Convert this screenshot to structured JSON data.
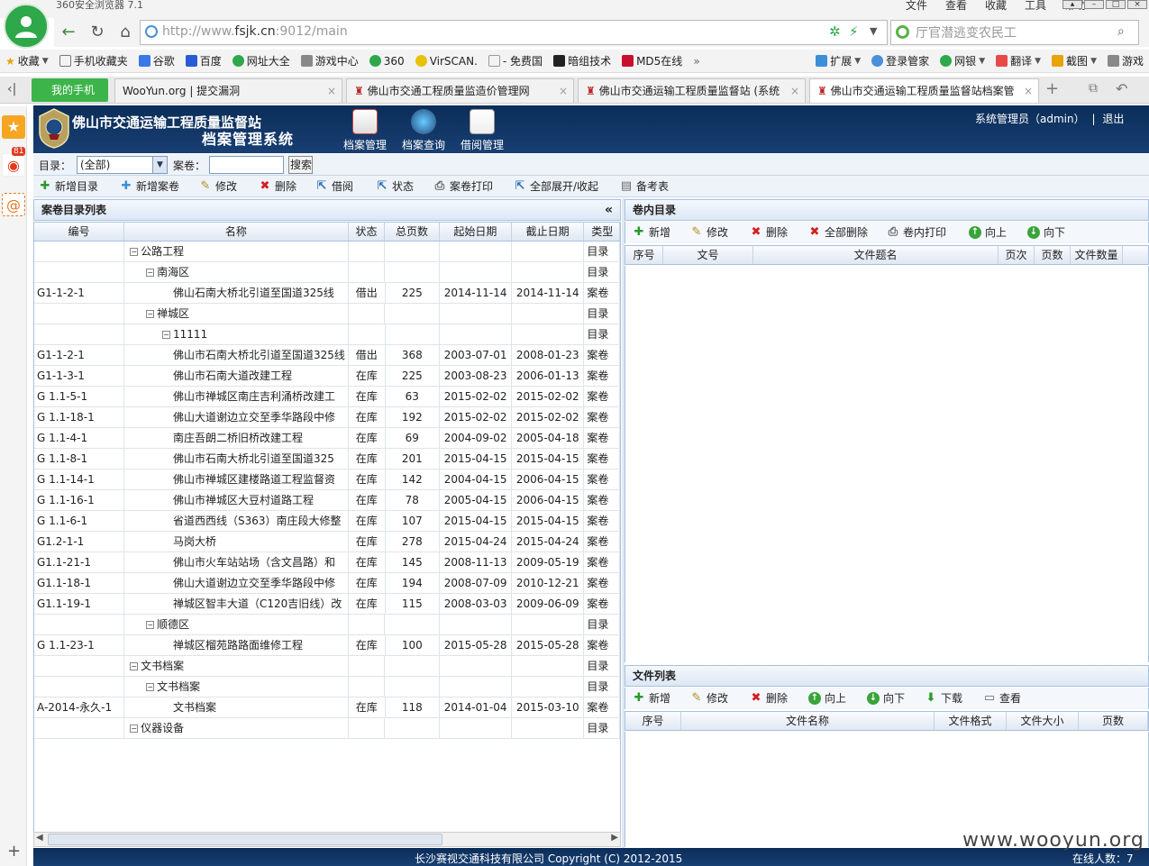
{
  "browser": {
    "title": "360安全浏览器 7.1",
    "menu": [
      "文件",
      "查看",
      "收藏",
      "工具",
      "帮助"
    ],
    "url_prefix": "http://www.",
    "url_domain": "fsjk.cn",
    "url_suffix": ":9012/main",
    "search_placeholder": "厅官潜逃变农民工",
    "favorites": [
      "收藏",
      "手机收藏夹",
      "谷歌",
      "百度",
      "网址大全",
      "游戏中心",
      "360",
      "VirSCAN.",
      "- 免费国",
      "暗组技术",
      "MD5在线"
    ],
    "favorites_right": [
      "扩展",
      "登录管家",
      "网银",
      "翻译",
      "截图",
      "游戏"
    ],
    "tabs": [
      {
        "label": "我的手机"
      },
      {
        "label": "WooYun.org | 提交漏洞"
      },
      {
        "label": "佛山市交通工程质量监造价管理网"
      },
      {
        "label": "佛山市交通运输工程质量监督站 (系统"
      },
      {
        "label": "佛山市交通运输工程质量监督站档案管"
      }
    ],
    "side_badge": "81"
  },
  "app": {
    "site_name": "佛山市交通运输工程质量监督站",
    "system_name": "档案管理系统",
    "modules": [
      "档案管理",
      "档案查询",
      "借阅管理"
    ],
    "user": "系统管理员（admin）",
    "logout": "退出",
    "filter": {
      "dir_label": "目录：",
      "dir_value": "(全部)",
      "vol_label": "案卷：",
      "vol_value": "",
      "search_button": "搜索"
    },
    "actions": [
      "新增目录",
      "新增案卷",
      "修改",
      "删除",
      "借阅",
      "状态",
      "案卷打印",
      "全部展开/收起",
      "备考表"
    ],
    "left_panel": {
      "title": "案卷目录列表",
      "collapse": "«",
      "columns": [
        "编号",
        "名称",
        "状态",
        "总页数",
        "起始日期",
        "截止日期",
        "类型"
      ],
      "rows": [
        {
          "code": "",
          "name": "公路工程",
          "level": 0,
          "node": true,
          "status": "",
          "pages": "",
          "start": "",
          "end": "",
          "type": "目录"
        },
        {
          "code": "",
          "name": "南海区",
          "level": 1,
          "node": true,
          "status": "",
          "pages": "",
          "start": "",
          "end": "",
          "type": "目录"
        },
        {
          "code": "G1-1-2-1",
          "name": "佛山石南大桥北引道至国道325线",
          "level": 2,
          "node": false,
          "status": "借出",
          "pages": "225",
          "start": "2014-11-14",
          "end": "2014-11-14",
          "type": "案卷"
        },
        {
          "code": "",
          "name": "禅城区",
          "level": 1,
          "node": true,
          "status": "",
          "pages": "",
          "start": "",
          "end": "",
          "type": "目录"
        },
        {
          "code": "",
          "name": "11111",
          "level": 2,
          "node": true,
          "status": "",
          "pages": "",
          "start": "",
          "end": "",
          "type": "目录"
        },
        {
          "code": "G1-1-2-1",
          "name": "佛山市石南大桥北引道至国道325线",
          "level": 2,
          "node": false,
          "status": "借出",
          "pages": "368",
          "start": "2003-07-01",
          "end": "2008-01-23",
          "type": "案卷"
        },
        {
          "code": "G1-1-3-1",
          "name": "佛山市石南大道改建工程",
          "level": 2,
          "node": false,
          "status": "在库",
          "pages": "225",
          "start": "2003-08-23",
          "end": "2006-01-13",
          "type": "案卷"
        },
        {
          "code": "G 1.1-5-1",
          "name": "佛山市禅城区南庄吉利涌桥改建工",
          "level": 2,
          "node": false,
          "status": "在库",
          "pages": "63",
          "start": "2015-02-02",
          "end": "2015-02-02",
          "type": "案卷"
        },
        {
          "code": "G 1.1-18-1",
          "name": "佛山大道谢边立交至季华路段中修",
          "level": 2,
          "node": false,
          "status": "在库",
          "pages": "192",
          "start": "2015-02-02",
          "end": "2015-02-02",
          "type": "案卷"
        },
        {
          "code": "G 1.1-4-1",
          "name": "南庄吾朗二桥旧桥改建工程",
          "level": 2,
          "node": false,
          "status": "在库",
          "pages": "69",
          "start": "2004-09-02",
          "end": "2005-04-18",
          "type": "案卷"
        },
        {
          "code": "G 1.1-8-1",
          "name": "佛山市石南大桥北引道至国道325",
          "level": 2,
          "node": false,
          "status": "在库",
          "pages": "201",
          "start": "2015-04-15",
          "end": "2015-04-15",
          "type": "案卷"
        },
        {
          "code": "G 1.1-14-1",
          "name": "佛山市禅城区建楼路道工程监督资",
          "level": 2,
          "node": false,
          "status": "在库",
          "pages": "142",
          "start": "2004-04-15",
          "end": "2006-04-15",
          "type": "案卷"
        },
        {
          "code": "G 1.1-16-1",
          "name": "佛山市禅城区大豆村道路工程",
          "level": 2,
          "node": false,
          "status": "在库",
          "pages": "78",
          "start": "2005-04-15",
          "end": "2006-04-15",
          "type": "案卷"
        },
        {
          "code": "G 1.1-6-1",
          "name": "省道西西线（S363）南庄段大修整",
          "level": 2,
          "node": false,
          "status": "在库",
          "pages": "107",
          "start": "2015-04-15",
          "end": "2015-04-15",
          "type": "案卷"
        },
        {
          "code": "G1.2-1-1",
          "name": "马岗大桥",
          "level": 2,
          "node": false,
          "status": "在库",
          "pages": "278",
          "start": "2015-04-24",
          "end": "2015-04-24",
          "type": "案卷"
        },
        {
          "code": "G1.1-21-1",
          "name": "佛山市火车站站场（含文昌路）和",
          "level": 2,
          "node": false,
          "status": "在库",
          "pages": "145",
          "start": "2008-11-13",
          "end": "2009-05-19",
          "type": "案卷"
        },
        {
          "code": "G1.1-18-1",
          "name": "佛山大道谢边立交至季华路段中修",
          "level": 2,
          "node": false,
          "status": "在库",
          "pages": "194",
          "start": "2008-07-09",
          "end": "2010-12-21",
          "type": "案卷"
        },
        {
          "code": "G1.1-19-1",
          "name": "禅城区智丰大道（C120吉旧线）改",
          "level": 2,
          "node": false,
          "status": "在库",
          "pages": "115",
          "start": "2008-03-03",
          "end": "2009-06-09",
          "type": "案卷"
        },
        {
          "code": "",
          "name": "顺德区",
          "level": 1,
          "node": true,
          "status": "",
          "pages": "",
          "start": "",
          "end": "",
          "type": "目录"
        },
        {
          "code": "G 1.1-23-1",
          "name": "禅城区榴苑路路面维修工程",
          "level": 2,
          "node": false,
          "status": "在库",
          "pages": "100",
          "start": "2015-05-28",
          "end": "2015-05-28",
          "type": "案卷"
        },
        {
          "code": "",
          "name": "文书档案",
          "level": 0,
          "node": true,
          "status": "",
          "pages": "",
          "start": "",
          "end": "",
          "type": "目录"
        },
        {
          "code": "",
          "name": "文书档案",
          "level": 1,
          "node": true,
          "status": "",
          "pages": "",
          "start": "",
          "end": "",
          "type": "目录"
        },
        {
          "code": "A-2014-永久-1",
          "name": "文书档案",
          "level": 2,
          "node": false,
          "status": "在库",
          "pages": "118",
          "start": "2014-01-04",
          "end": "2015-03-10",
          "type": "案卷"
        },
        {
          "code": "",
          "name": "仪器设备",
          "level": 0,
          "node": true,
          "status": "",
          "pages": "",
          "start": "",
          "end": "",
          "type": "目录"
        }
      ]
    },
    "inner_panel": {
      "title": "卷内目录",
      "actions": [
        "新增",
        "修改",
        "删除",
        "全部删除",
        "卷内打印",
        "向上",
        "向下"
      ],
      "columns": [
        "序号",
        "文号",
        "文件题名",
        "页次",
        "页数",
        "文件数量"
      ]
    },
    "file_panel": {
      "title": "文件列表",
      "actions": [
        "新增",
        "修改",
        "删除",
        "向上",
        "向下",
        "下载",
        "查看"
      ],
      "columns": [
        "序号",
        "文件名称",
        "文件格式",
        "文件大小",
        "页数"
      ]
    },
    "footer": {
      "copyright": "长沙赛视交通科技有限公司 Copyright (C) 2012-2015",
      "online": "在线人数：7"
    },
    "watermark": "www.wooyun.org"
  }
}
